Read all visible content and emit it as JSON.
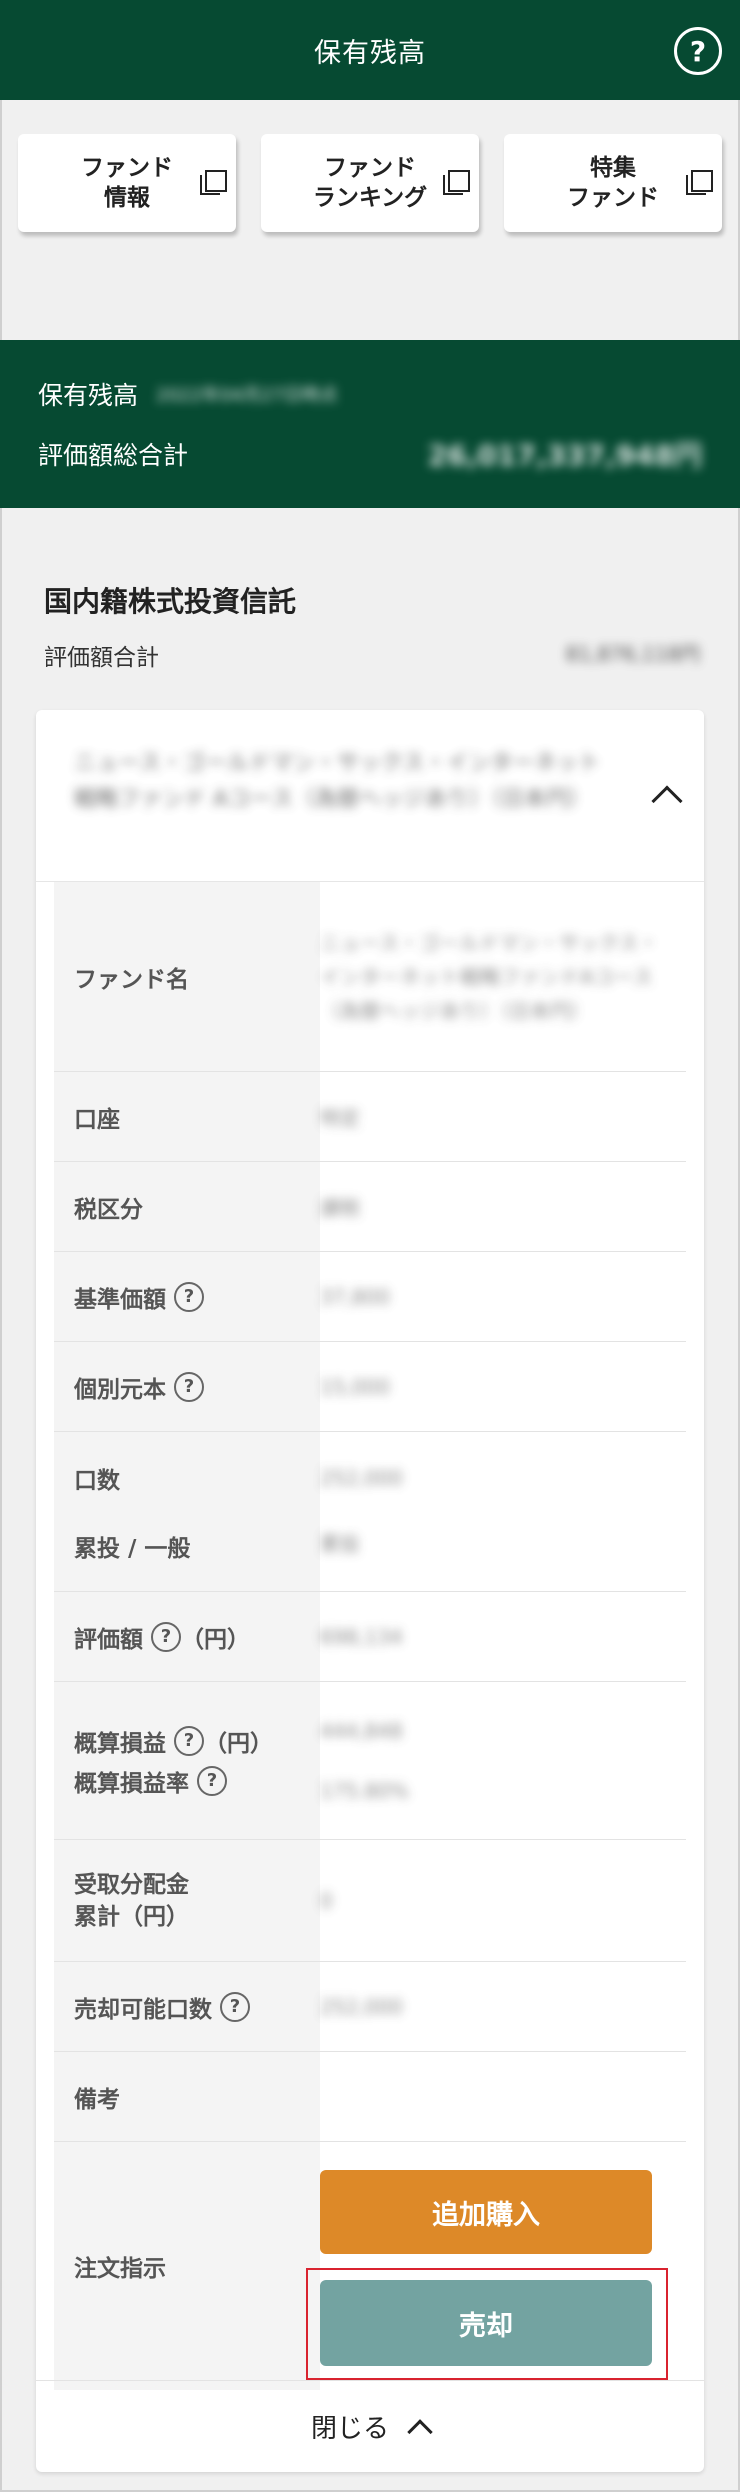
{
  "header": {
    "title": "保有残高",
    "help": "?"
  },
  "nav": [
    {
      "label": "ファンド\n情報"
    },
    {
      "label": "ファンド\nランキング"
    },
    {
      "label": "特集\nファンド"
    }
  ],
  "summary": {
    "balance_label": "保有残高",
    "date": "2022年04月27日時点",
    "total_label": "評価額総合計",
    "total_value": "26,017,337,948円"
  },
  "section": {
    "title": "国内籍株式投資信託",
    "subtotal_label": "評価額合計",
    "subtotal_value": "81,876,118円"
  },
  "fund": {
    "name": "ニュース・ゴールドマン・サックス・インターネット戦略ファンド Aコース（為替ヘッジあり）（日本円）",
    "close_label": "閉じる"
  },
  "details": {
    "fund_name_label": "ファンド名",
    "fund_name_value": "ニュース・ゴールドマン・サックス・インターネット戦略ファンドAコース（為替ヘッジあり）（日本円）",
    "account_label": "口座",
    "account_value": "特定",
    "tax_label": "税区分",
    "tax_value": "課税",
    "nav_price_label": "基準価額",
    "nav_price_value": "37,800",
    "principal_label": "個別元本",
    "principal_value": "15,000",
    "units_label": "口数",
    "units_value": "252,000",
    "type_label": "累投 / 一般",
    "type_value": "累投",
    "eval_label": "評価額",
    "eval_unit": "（円）",
    "eval_value": "698,134",
    "pl_label": "概算損益",
    "pl_unit": "（円）",
    "pl_rate_label": "概算損益率",
    "pl_value": "444,848",
    "pl_rate_value": "175.80%",
    "dist_label": "受取分配金\n累計（円）",
    "dist_value": "0",
    "sellable_label": "売却可能口数",
    "sellable_value": "252,000",
    "notes_label": "備考",
    "order_label": "注文指示",
    "buy_label": "追加購入",
    "sell_label": "売却"
  },
  "colors": {
    "brand": "#064a32",
    "buy": "#dd8928",
    "sell": "#73a3a1",
    "highlight": "#d9232f"
  }
}
